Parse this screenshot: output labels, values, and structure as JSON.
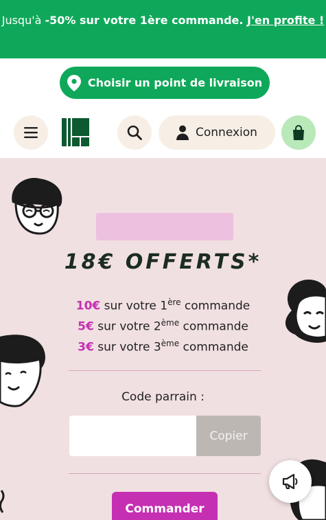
{
  "promo": {
    "lead": "Jusqu'à ",
    "highlight": "-50% sur votre 1ère commande.",
    "link": "J'en profite !"
  },
  "header": {
    "delivery_label": "Choisir un point de livraison",
    "login_label": "Connexion",
    "icons": [
      "menu-icon",
      "logo",
      "search-icon",
      "user-icon",
      "bag-icon",
      "location-pin-icon"
    ]
  },
  "main": {
    "title": "18€ OFFERTS*",
    "offers": [
      {
        "amount": "10€",
        "text": " sur votre 1",
        "sup": "ère",
        "tail": " commande"
      },
      {
        "amount": "5€",
        "text": " sur votre 2",
        "sup": "ème",
        "tail": " commande"
      },
      {
        "amount": "3€",
        "text": " sur votre 3",
        "sup": "ème",
        "tail": " commande"
      }
    ],
    "code_label": "Code parrain :",
    "code_value": "",
    "copy_label": "Copier",
    "order_label": "Commander"
  },
  "colors": {
    "green": "#0fa85a",
    "dark_green": "#0d5a30",
    "magenta": "#c52fb2",
    "pink_bg": "#f1e0e2"
  },
  "feedback": {
    "icon": "megaphone-icon"
  }
}
